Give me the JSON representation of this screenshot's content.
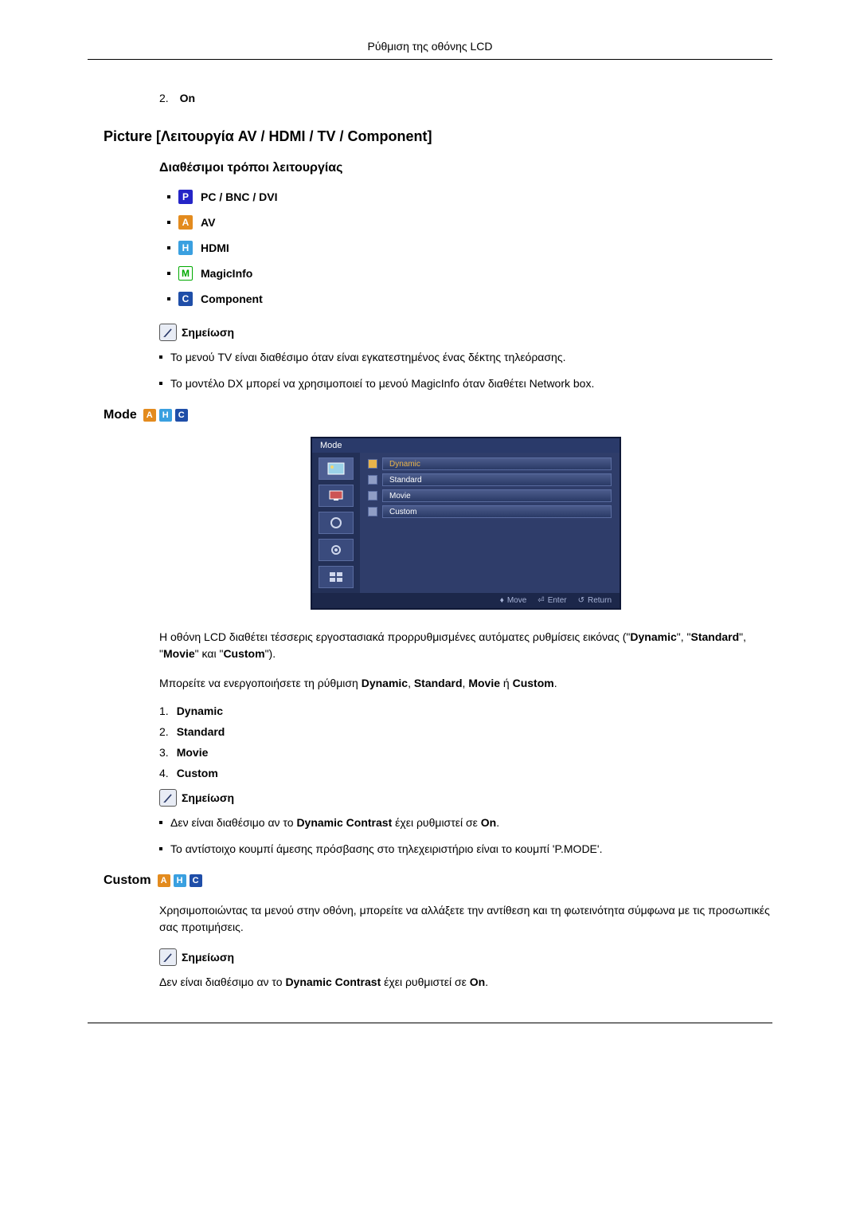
{
  "header": "Ρύθμιση της οθόνης LCD",
  "enum_prev": {
    "num": "2.",
    "label": "On"
  },
  "picture_heading": "Picture [Λειτουργία AV / HDMI / TV / Component]",
  "available_modes_heading": "Διαθέσιμοι τρόποι λειτουργίας",
  "mode_list": {
    "p": "PC / BNC / DVI",
    "a": "AV",
    "h": "HDMI",
    "m": "MagicInfo",
    "c": "Component"
  },
  "note_label": "Σημείωση",
  "note1": {
    "b1": "Το μενού TV είναι διαθέσιμο όταν είναι εγκατεστημένος ένας δέκτης τηλεόρασης.",
    "b2": "Το μοντέλο DX μπορεί να χρησιμοποιεί το μενού MagicInfo όταν διαθέτει Network box."
  },
  "mode_heading": "Mode",
  "osd_menu": {
    "title": "Mode",
    "items": [
      "Dynamic",
      "Standard",
      "Movie",
      "Custom"
    ],
    "footer": {
      "move": "Move",
      "enter": "Enter",
      "return": "Return"
    }
  },
  "mode_desc": {
    "p1_pre": "Η οθόνη LCD διαθέτει τέσσερις εργοστασιακά προρρυθμισμένες αυτόματες ρυθμίσεις εικόνας (\"",
    "t1": "Dynamic",
    "sep1": "\", \"",
    "t2": "Standard",
    "sep2": "\", \"",
    "t3": "Movie",
    "sep3": "\" και \"",
    "t4": "Custom",
    "p1_post": "\").",
    "p2_pre": "Μπορείτε να ενεργοποιήσετε τη ρύθμιση ",
    "p2_t1": "Dynamic",
    "p2_s1": ", ",
    "p2_t2": "Standard",
    "p2_s2": ", ",
    "p2_t3": "Movie",
    "p2_s3": " ή ",
    "p2_t4": "Custom",
    "p2_post": "."
  },
  "mode_enum": [
    {
      "num": "1.",
      "label": "Dynamic"
    },
    {
      "num": "2.",
      "label": "Standard"
    },
    {
      "num": "3.",
      "label": "Movie"
    },
    {
      "num": "4.",
      "label": "Custom"
    }
  ],
  "note2": {
    "b1_pre": "Δεν είναι διαθέσιμο αν το ",
    "b1_bold1": "Dynamic Contrast",
    "b1_mid": " έχει ρυθμιστεί σε ",
    "b1_bold2": "On",
    "b1_post": ".",
    "b2": "Το αντίστοιχο κουμπί άμεσης πρόσβασης στο τηλεχειριστήριο είναι το κουμπί 'P.MODE'."
  },
  "custom_heading": "Custom",
  "custom_desc": "Χρησιμοποιώντας τα μενού στην οθόνη, μπορείτε να αλλάξετε την αντίθεση και τη φωτεινότητα σύμφωνα με τις προσωπικές σας προτιμήσεις.",
  "note3": {
    "pre": "Δεν είναι διαθέσιμο αν το ",
    "bold1": "Dynamic Contrast",
    "mid": " έχει ρυθμιστεί σε ",
    "bold2": "On",
    "post": "."
  },
  "badge_letters": {
    "p": "P",
    "a": "A",
    "h": "H",
    "m": "M",
    "c": "C"
  },
  "footer_glyphs": {
    "move": "♦",
    "enter": "⏎",
    "return": "↺"
  }
}
